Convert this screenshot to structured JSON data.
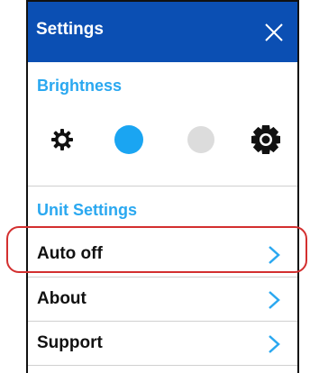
{
  "header": {
    "title": "Settings",
    "close_icon": "close-icon",
    "color": "#0b4fb3"
  },
  "brightness": {
    "title": "Brightness",
    "levels": [
      {
        "icon": "brightness-low-icon"
      },
      {
        "icon": "brightness-dot-selected",
        "color": "#1aa5f2"
      },
      {
        "icon": "brightness-dot",
        "color": "#dcdcdc"
      },
      {
        "icon": "brightness-high-icon"
      }
    ]
  },
  "unit_settings": {
    "title": "Unit  Settings",
    "items": [
      {
        "label": "Auto  off",
        "icon": "chevron-right-icon"
      },
      {
        "label": "About",
        "icon": "chevron-right-icon"
      },
      {
        "label": "Support",
        "icon": "chevron-right-icon"
      }
    ]
  },
  "accent_color": "#2aa8f0",
  "highlight_color": "#d32f2f"
}
